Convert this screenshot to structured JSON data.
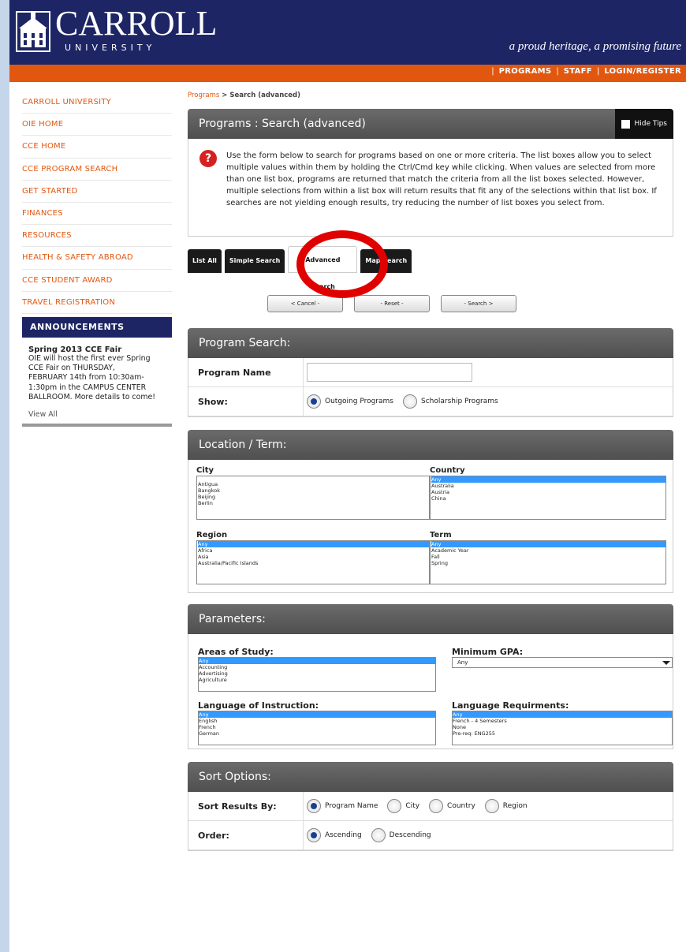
{
  "header": {
    "logo_word": "CARROLL",
    "logo_sub": "UNIVERSITY",
    "tagline": "a proud heritage, a promising future",
    "nav": [
      "PROGRAMS",
      "STAFF",
      "LOGIN/REGISTER"
    ]
  },
  "sidebar": {
    "items": [
      "CARROLL UNIVERSITY",
      "OIE HOME",
      "CCE HOME",
      "CCE PROGRAM SEARCH",
      "GET STARTED",
      "FINANCES",
      "RESOURCES",
      "HEALTH & SAFETY ABROAD",
      "CCE STUDENT AWARD",
      "TRAVEL REGISTRATION"
    ],
    "announcements_heading": "ANNOUNCEMENTS",
    "announcement_title": "Spring 2013 CCE Fair",
    "announcement_text": "OIE will host the first ever Spring CCE Fair on THURSDAY, FEBRUARY 14th from 10:30am-1:30pm in the CAMPUS CENTER BALLROOM. More details to come!",
    "view_all": "View All"
  },
  "breadcrumb": {
    "link": "Programs",
    "sep": " > ",
    "current": "Search (advanced)"
  },
  "page_title": "Programs : Search (advanced)",
  "hide_tips_label": "Hide Tips",
  "tips_text": "Use the form below to search for programs based on one or more criteria. The list boxes allow you to select multiple values within them by holding the Ctrl/Cmd key while clicking. When values are selected from more than one list box, programs are returned that match the criteria from all the list boxes selected. However, multiple selections from within a list box will return results that fit any of the selections within that list box. If searches are not yielding enough results, try reducing the number of list boxes you select from.",
  "tabs": [
    "List All",
    "Simple Search",
    "Advanced Search",
    "Map Search"
  ],
  "active_tab": "Advanced Search",
  "buttons": {
    "cancel": "< Cancel -",
    "reset": "- Reset -",
    "search": "- Search >"
  },
  "program_search": {
    "heading": "Program Search:",
    "name_label": "Program Name",
    "name_value": "",
    "show_label": "Show:",
    "show_options": [
      "Outgoing Programs",
      "Scholarship Programs"
    ],
    "show_selected": "Outgoing Programs"
  },
  "location_term": {
    "heading": "Location / Term:",
    "city_label": "City",
    "city_options": [
      "Antigua",
      "Bangkok",
      "Beijing",
      "Berlin"
    ],
    "country_label": "Country",
    "country_options": [
      "Any",
      "Australia",
      "Austria",
      "China"
    ],
    "country_selected": "Any",
    "region_label": "Region",
    "region_options": [
      "Any",
      "Africa",
      "Asia",
      "Australia/Pacific Islands"
    ],
    "region_selected": "Any",
    "term_label": "Term",
    "term_options": [
      "Any",
      "Academic Year",
      "Fall",
      "Spring"
    ],
    "term_selected": "Any"
  },
  "parameters": {
    "heading": "Parameters:",
    "areas_label": "Areas of Study:",
    "areas_options": [
      "Any",
      "Accounting",
      "Advertising",
      "Agriculture"
    ],
    "areas_selected": "Any",
    "gpa_label": "Minimum GPA:",
    "gpa_value": "Any",
    "instruction_label": "Language of Instruction:",
    "instruction_options": [
      "Any",
      "English",
      "French",
      "German"
    ],
    "instruction_selected": "Any",
    "requirements_label": "Language Requirments:",
    "requirements_options": [
      "Any",
      "French - 4 Semesters",
      "None",
      "Pre-req: ENG255"
    ],
    "requirements_selected": "Any"
  },
  "sort_options": {
    "heading": "Sort Options:",
    "sort_label": "Sort Results By:",
    "sort_choices": [
      "Program Name",
      "City",
      "Country",
      "Region"
    ],
    "sort_selected": "Program Name",
    "order_label": "Order:",
    "order_choices": [
      "Ascending",
      "Descending"
    ],
    "order_selected": "Ascending"
  },
  "colors": {
    "navy": "#1d2565",
    "orange": "#e2570f",
    "panel_header": "#5a5a5a",
    "highlight_circle": "#e00000",
    "list_selected": "#3399ff"
  }
}
